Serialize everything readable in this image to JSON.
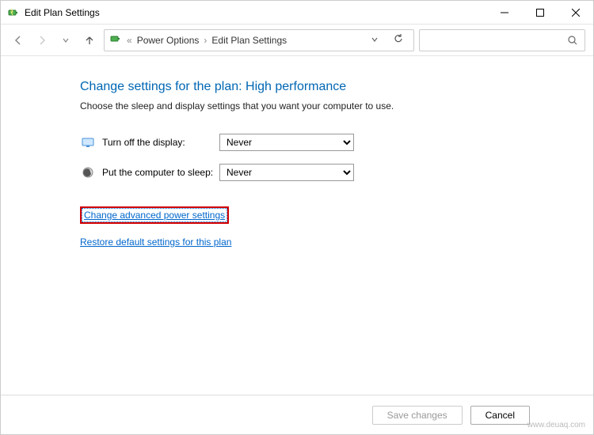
{
  "title": "Edit Plan Settings",
  "breadcrumb": {
    "parent": "Power Options",
    "current": "Edit Plan Settings"
  },
  "heading": "Change settings for the plan: High performance",
  "subtext": "Choose the sleep and display settings that you want your computer to use.",
  "rows": {
    "display": {
      "label": "Turn off the display:",
      "value": "Never"
    },
    "sleep": {
      "label": "Put the computer to sleep:",
      "value": "Never"
    }
  },
  "links": {
    "advanced": "Change advanced power settings",
    "restore": "Restore default settings for this plan"
  },
  "footer": {
    "save": "Save changes",
    "cancel": "Cancel"
  },
  "watermark": "www.deuaq.com"
}
